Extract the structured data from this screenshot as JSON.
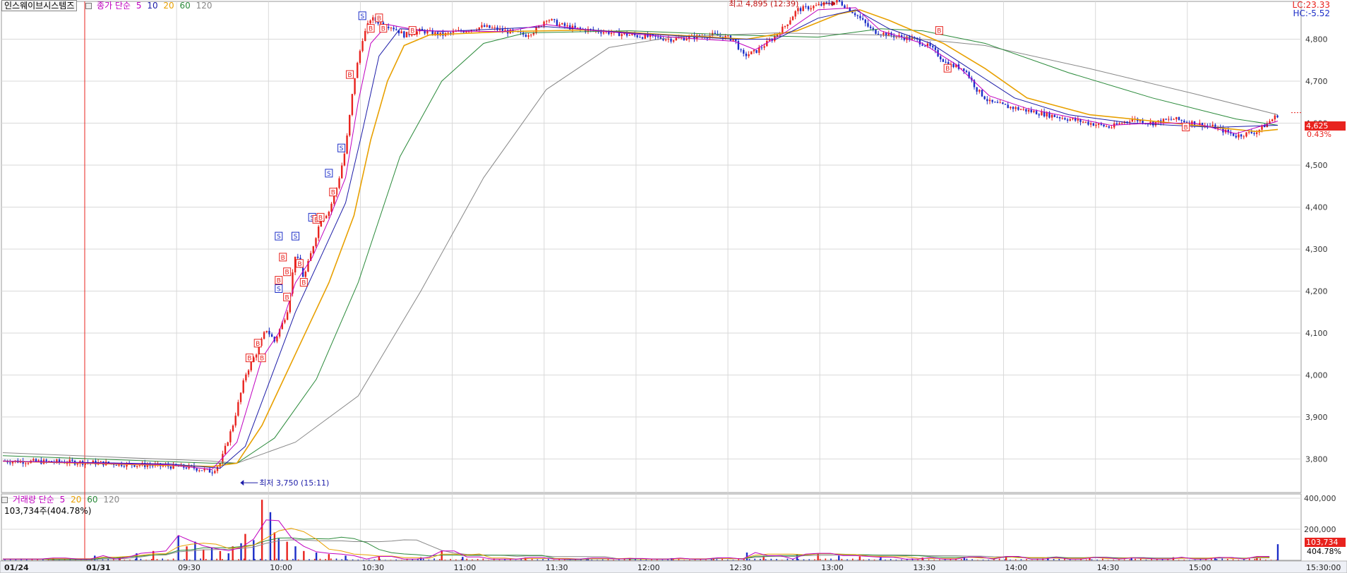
{
  "legend": {
    "title": "인스웨이브시스템즈",
    "label": "종가 단순",
    "periods": [
      "5",
      "10",
      "20",
      "60",
      "120"
    ],
    "period_colors": [
      "#c000c0",
      "#1c1ca8",
      "#e8a000",
      "#2a8a3a",
      "#888888"
    ]
  },
  "volume_legend": {
    "label": "거래량 단순",
    "periods": [
      "5",
      "20",
      "60",
      "120"
    ],
    "period_colors": [
      "#c000c0",
      "#e8a000",
      "#2a8a3a",
      "#888888"
    ],
    "last": "103,734주(404.78%)"
  },
  "right_info": {
    "lc": "LC:23.33",
    "hc": "HC:-5.52"
  },
  "current": {
    "price": "4,625",
    "change_pct": "0.43%",
    "volume": "103,734",
    "volume_pct": "404.78%"
  },
  "colors": {
    "up": "#e8231e",
    "down": "#1c2ec8",
    "grid": "#d9d9d9"
  },
  "chart_data": [
    {
      "type": "candlestick",
      "title": "인스웨이브시스템즈",
      "y_ticks": [
        "3,800",
        "3,900",
        "4,000",
        "4,100",
        "4,200",
        "4,300",
        "4,400",
        "4,500",
        "4,600",
        "4,700",
        "4,800"
      ],
      "ylim": [
        3720,
        4890
      ],
      "x_ticks": [
        "01/24",
        "01/31",
        "09:30",
        "10:00",
        "10:30",
        "11:00",
        "11:30",
        "12:00",
        "12:30",
        "13:00",
        "13:30",
        "14:00",
        "14:30",
        "15:00",
        "15:30:00"
      ],
      "annotations": {
        "high": "최고 4,895 (12:39)",
        "low": "최저 3,750 (15:11)"
      },
      "close_path": [
        [
          0,
          3795
        ],
        [
          20,
          3792
        ],
        [
          35,
          3785
        ],
        [
          45,
          3780
        ],
        [
          50,
          3770
        ],
        [
          52,
          3790
        ],
        [
          55,
          3880
        ],
        [
          58,
          4000
        ],
        [
          61,
          4060
        ],
        [
          63,
          4110
        ],
        [
          65,
          4080
        ],
        [
          68,
          4150
        ],
        [
          70,
          4290
        ],
        [
          72,
          4230
        ],
        [
          74,
          4300
        ],
        [
          76,
          4370
        ],
        [
          78,
          4390
        ],
        [
          80,
          4450
        ],
        [
          82,
          4540
        ],
        [
          84,
          4700
        ],
        [
          86,
          4800
        ],
        [
          88,
          4850
        ],
        [
          90,
          4840
        ],
        [
          93,
          4830
        ],
        [
          96,
          4810
        ],
        [
          100,
          4820
        ],
        [
          105,
          4810
        ],
        [
          110,
          4820
        ],
        [
          115,
          4830
        ],
        [
          120,
          4820
        ],
        [
          125,
          4810
        ],
        [
          128,
          4825
        ],
        [
          130,
          4850
        ],
        [
          133,
          4835
        ],
        [
          137,
          4825
        ],
        [
          142,
          4820
        ],
        [
          150,
          4810
        ],
        [
          160,
          4800
        ],
        [
          170,
          4810
        ],
        [
          175,
          4800
        ],
        [
          177,
          4760
        ],
        [
          180,
          4770
        ],
        [
          184,
          4800
        ],
        [
          187,
          4830
        ],
        [
          190,
          4870
        ],
        [
          195,
          4880
        ],
        [
          200,
          4890
        ],
        [
          204,
          4860
        ],
        [
          208,
          4820
        ],
        [
          212,
          4810
        ],
        [
          218,
          4800
        ],
        [
          222,
          4780
        ],
        [
          226,
          4740
        ],
        [
          230,
          4730
        ],
        [
          233,
          4680
        ],
        [
          236,
          4650
        ],
        [
          240,
          4640
        ],
        [
          245,
          4630
        ],
        [
          250,
          4620
        ],
        [
          255,
          4610
        ],
        [
          260,
          4600
        ],
        [
          265,
          4590
        ],
        [
          270,
          4610
        ],
        [
          275,
          4600
        ],
        [
          280,
          4610
        ],
        [
          285,
          4600
        ],
        [
          290,
          4590
        ],
        [
          295,
          4570
        ],
        [
          300,
          4580
        ],
        [
          305,
          4620
        ]
      ],
      "ma_5": [
        [
          0,
          3795
        ],
        [
          40,
          3786
        ],
        [
          50,
          3775
        ],
        [
          56,
          3840
        ],
        [
          62,
          4040
        ],
        [
          66,
          4100
        ],
        [
          70,
          4220
        ],
        [
          74,
          4280
        ],
        [
          78,
          4370
        ],
        [
          82,
          4470
        ],
        [
          85,
          4650
        ],
        [
          88,
          4790
        ],
        [
          92,
          4835
        ],
        [
          100,
          4820
        ],
        [
          120,
          4818
        ],
        [
          130,
          4835
        ],
        [
          140,
          4822
        ],
        [
          160,
          4805
        ],
        [
          175,
          4795
        ],
        [
          180,
          4775
        ],
        [
          187,
          4815
        ],
        [
          195,
          4870
        ],
        [
          204,
          4875
        ],
        [
          210,
          4820
        ],
        [
          220,
          4790
        ],
        [
          228,
          4740
        ],
        [
          236,
          4665
        ],
        [
          245,
          4635
        ],
        [
          255,
          4615
        ],
        [
          265,
          4595
        ],
        [
          275,
          4600
        ],
        [
          285,
          4600
        ],
        [
          295,
          4575
        ],
        [
          305,
          4605
        ]
      ],
      "ma_10": [
        [
          0,
          3795
        ],
        [
          40,
          3788
        ],
        [
          52,
          3778
        ],
        [
          58,
          3830
        ],
        [
          64,
          3990
        ],
        [
          70,
          4150
        ],
        [
          76,
          4280
        ],
        [
          82,
          4410
        ],
        [
          86,
          4580
        ],
        [
          90,
          4760
        ],
        [
          95,
          4825
        ],
        [
          105,
          4818
        ],
        [
          130,
          4830
        ],
        [
          150,
          4815
        ],
        [
          175,
          4800
        ],
        [
          185,
          4800
        ],
        [
          195,
          4850
        ],
        [
          204,
          4870
        ],
        [
          212,
          4825
        ],
        [
          222,
          4790
        ],
        [
          232,
          4725
        ],
        [
          242,
          4660
        ],
        [
          255,
          4620
        ],
        [
          270,
          4600
        ],
        [
          290,
          4590
        ],
        [
          305,
          4595
        ]
      ],
      "ma_20": [
        [
          0,
          3795
        ],
        [
          50,
          3782
        ],
        [
          56,
          3790
        ],
        [
          62,
          3880
        ],
        [
          70,
          4050
        ],
        [
          78,
          4220
        ],
        [
          84,
          4380
        ],
        [
          88,
          4560
        ],
        [
          92,
          4700
        ],
        [
          96,
          4785
        ],
        [
          102,
          4810
        ],
        [
          120,
          4818
        ],
        [
          140,
          4822
        ],
        [
          160,
          4810
        ],
        [
          178,
          4800
        ],
        [
          190,
          4820
        ],
        [
          200,
          4860
        ],
        [
          205,
          4870
        ],
        [
          212,
          4845
        ],
        [
          225,
          4790
        ],
        [
          235,
          4730
        ],
        [
          245,
          4660
        ],
        [
          260,
          4620
        ],
        [
          280,
          4600
        ],
        [
          300,
          4580
        ],
        [
          305,
          4585
        ]
      ],
      "ma_60": [
        [
          0,
          3808
        ],
        [
          50,
          3790
        ],
        [
          56,
          3790
        ],
        [
          65,
          3850
        ],
        [
          75,
          3990
        ],
        [
          85,
          4220
        ],
        [
          95,
          4520
        ],
        [
          105,
          4700
        ],
        [
          115,
          4790
        ],
        [
          125,
          4815
        ],
        [
          150,
          4820
        ],
        [
          175,
          4810
        ],
        [
          195,
          4805
        ],
        [
          210,
          4825
        ],
        [
          220,
          4820
        ],
        [
          235,
          4790
        ],
        [
          255,
          4720
        ],
        [
          275,
          4660
        ],
        [
          295,
          4610
        ],
        [
          305,
          4595
        ]
      ],
      "ma_120": [
        [
          0,
          3815
        ],
        [
          50,
          3795
        ],
        [
          56,
          3790
        ],
        [
          70,
          3840
        ],
        [
          85,
          3950
        ],
        [
          100,
          4200
        ],
        [
          115,
          4470
        ],
        [
          130,
          4680
        ],
        [
          145,
          4780
        ],
        [
          160,
          4805
        ],
        [
          185,
          4815
        ],
        [
          210,
          4810
        ],
        [
          235,
          4785
        ],
        [
          260,
          4730
        ],
        [
          285,
          4670
        ],
        [
          305,
          4620
        ]
      ],
      "trade_marks": [
        {
          "t": 86,
          "p": 4855,
          "type": "S"
        },
        {
          "t": 90,
          "p": 4850,
          "type": "B"
        },
        {
          "t": 91,
          "p": 4825,
          "type": "B"
        },
        {
          "t": 88,
          "p": 4825,
          "type": "B"
        },
        {
          "t": 83,
          "p": 4715,
          "type": "B"
        },
        {
          "t": 81,
          "p": 4540,
          "type": "S"
        },
        {
          "t": 78,
          "p": 4480,
          "type": "S"
        },
        {
          "t": 79,
          "p": 4435,
          "type": "B"
        },
        {
          "t": 74,
          "p": 4375,
          "type": "S"
        },
        {
          "t": 75,
          "p": 4370,
          "type": "B"
        },
        {
          "t": 76,
          "p": 4375,
          "type": "B"
        },
        {
          "t": 70,
          "p": 4330,
          "type": "S"
        },
        {
          "t": 66,
          "p": 4330,
          "type": "S"
        },
        {
          "t": 67,
          "p": 4280,
          "type": "B"
        },
        {
          "t": 71,
          "p": 4265,
          "type": "B"
        },
        {
          "t": 72,
          "p": 4220,
          "type": "B"
        },
        {
          "t": 68,
          "p": 4245,
          "type": "B"
        },
        {
          "t": 66,
          "p": 4225,
          "type": "B"
        },
        {
          "t": 66,
          "p": 4205,
          "type": "S"
        },
        {
          "t": 68,
          "p": 4185,
          "type": "B"
        },
        {
          "t": 61,
          "p": 4075,
          "type": "B"
        },
        {
          "t": 59,
          "p": 4040,
          "type": "B"
        },
        {
          "t": 62,
          "p": 4040,
          "type": "B"
        },
        {
          "t": 98,
          "p": 4820,
          "type": "B"
        },
        {
          "t": 224,
          "p": 4820,
          "type": "B"
        },
        {
          "t": 226,
          "p": 4730,
          "type": "B"
        },
        {
          "t": 283,
          "p": 4590,
          "type": "B"
        },
        {
          "t": 347,
          "p": 4620,
          "type": "B"
        }
      ]
    },
    {
      "type": "bar",
      "title": "거래량",
      "y_ticks": [
        "200,000",
        "400,000"
      ],
      "ylim": [
        0,
        400000
      ],
      "bars": [
        [
          12,
          15000
        ],
        [
          22,
          30000
        ],
        [
          28,
          20000
        ],
        [
          32,
          45000
        ],
        [
          36,
          60000
        ],
        [
          42,
          160000
        ],
        [
          44,
          90000
        ],
        [
          46,
          120000
        ],
        [
          48,
          70000
        ],
        [
          50,
          80000
        ],
        [
          52,
          60000
        ],
        [
          54,
          45000
        ],
        [
          55,
          90000
        ],
        [
          57,
          110000
        ],
        [
          58,
          170000
        ],
        [
          60,
          130000
        ],
        [
          62,
          390000
        ],
        [
          64,
          310000
        ],
        [
          65,
          180000
        ],
        [
          66,
          140000
        ],
        [
          68,
          120000
        ],
        [
          70,
          90000
        ],
        [
          72,
          60000
        ],
        [
          75,
          50000
        ],
        [
          78,
          40000
        ],
        [
          82,
          30000
        ],
        [
          90,
          25000
        ],
        [
          100,
          20000
        ],
        [
          105,
          60000
        ],
        [
          110,
          22000
        ],
        [
          125,
          18000
        ],
        [
          140,
          15000
        ],
        [
          150,
          12000
        ],
        [
          160,
          14000
        ],
        [
          170,
          16000
        ],
        [
          178,
          50000
        ],
        [
          182,
          30000
        ],
        [
          190,
          40000
        ],
        [
          195,
          45000
        ],
        [
          200,
          30000
        ],
        [
          205,
          25000
        ],
        [
          210,
          20000
        ],
        [
          220,
          18000
        ],
        [
          230,
          22000
        ],
        [
          240,
          25000
        ],
        [
          250,
          20000
        ],
        [
          260,
          18000
        ],
        [
          270,
          15000
        ],
        [
          280,
          20000
        ],
        [
          290,
          18000
        ],
        [
          300,
          25000
        ],
        [
          305,
          103734
        ]
      ]
    }
  ]
}
